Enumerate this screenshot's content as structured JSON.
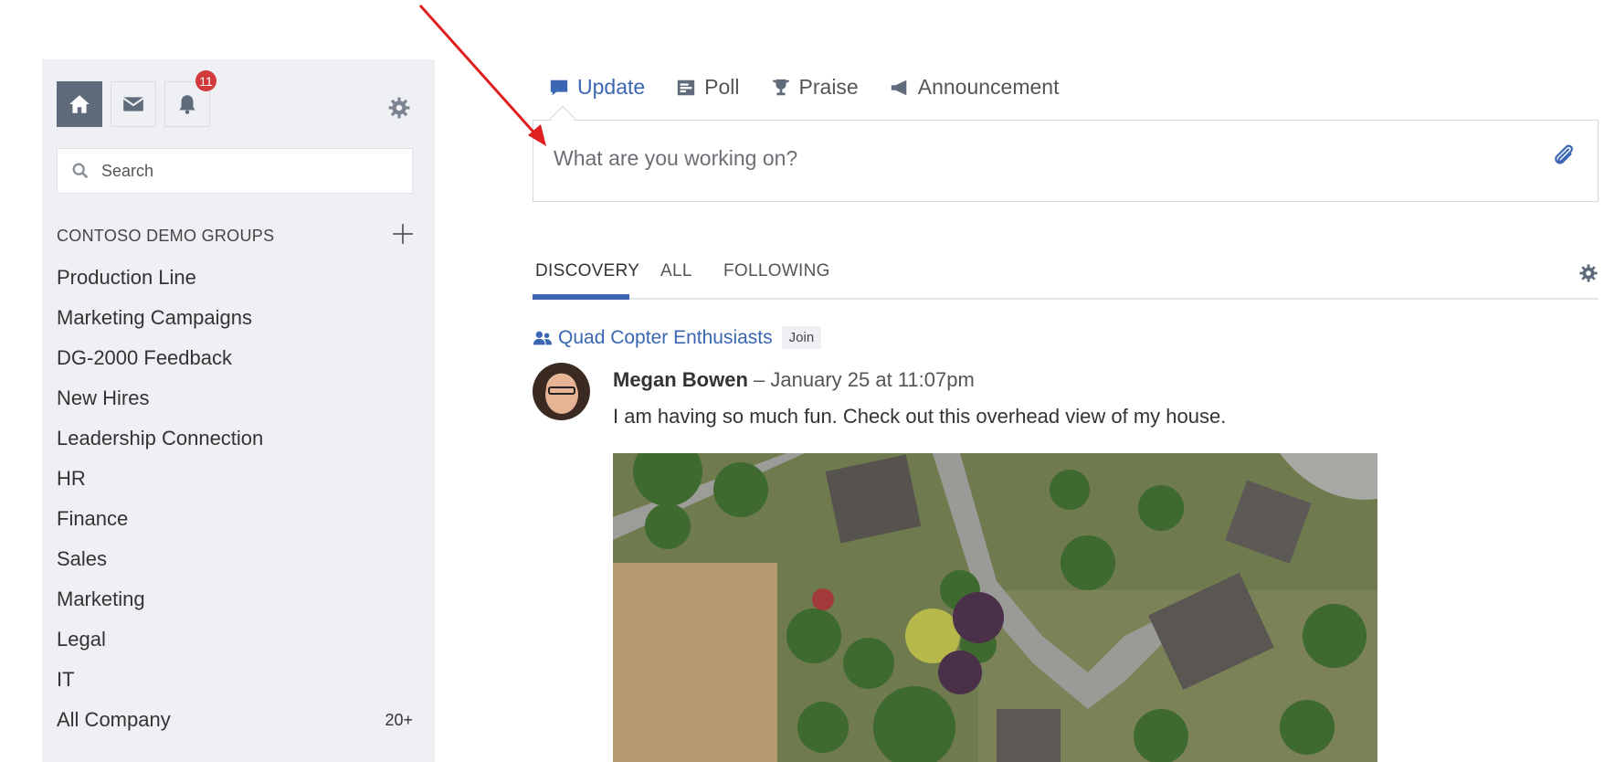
{
  "sidebar": {
    "notification_count": "11",
    "search_placeholder": "Search",
    "groups_header": "CONTOSO DEMO GROUPS",
    "groups": [
      {
        "label": "Production Line",
        "count": ""
      },
      {
        "label": "Marketing Campaigns",
        "count": ""
      },
      {
        "label": "DG-2000 Feedback",
        "count": ""
      },
      {
        "label": "New Hires",
        "count": ""
      },
      {
        "label": "Leadership Connection",
        "count": ""
      },
      {
        "label": "HR",
        "count": ""
      },
      {
        "label": "Finance",
        "count": ""
      },
      {
        "label": "Sales",
        "count": ""
      },
      {
        "label": "Marketing",
        "count": ""
      },
      {
        "label": "Legal",
        "count": ""
      },
      {
        "label": "IT",
        "count": ""
      },
      {
        "label": "All Company",
        "count": "20+"
      }
    ]
  },
  "composer": {
    "tabs": [
      {
        "label": "Update",
        "icon": "speech-bubble-icon"
      },
      {
        "label": "Poll",
        "icon": "poll-icon"
      },
      {
        "label": "Praise",
        "icon": "trophy-icon"
      },
      {
        "label": "Announcement",
        "icon": "megaphone-icon"
      }
    ],
    "placeholder": "What are you working on?"
  },
  "feed": {
    "tabs": [
      "DISCOVERY",
      "ALL",
      "FOLLOWING"
    ],
    "active_tab": "DISCOVERY"
  },
  "post": {
    "group_name": "Quad Copter Enthusiasts",
    "join_label": "Join",
    "author": "Megan Bowen",
    "separator": "–",
    "time": "January 25 at 11:07pm",
    "body": "I am having so much fun. Check out this overhead view of my house."
  },
  "colors": {
    "accent": "#3a66b2",
    "sidebar_bg": "#eef0f4",
    "badge": "#d23b3b",
    "annotation": "#e02020"
  }
}
